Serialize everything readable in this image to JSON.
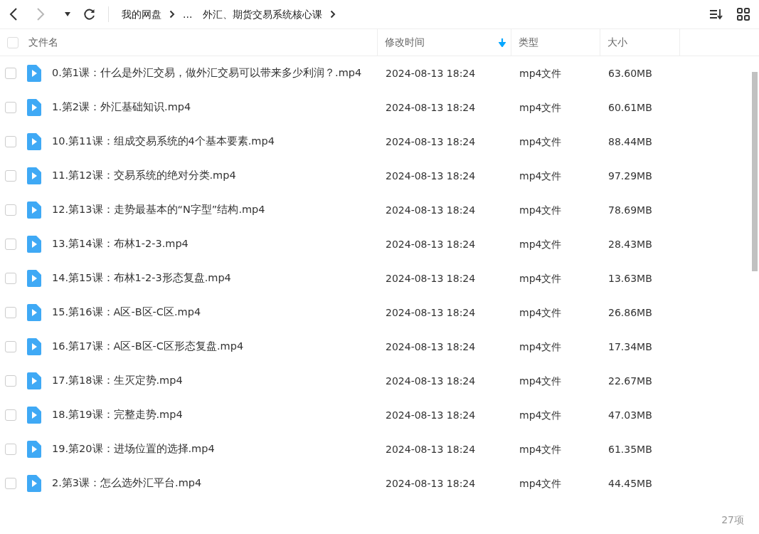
{
  "toolbar": {
    "breadcrumbs": [
      "我的网盘",
      "...",
      "外汇、期货交易系统核心课"
    ],
    "back_disabled": false,
    "forward_disabled": true
  },
  "table": {
    "select_all": {
      "checked": false
    },
    "columns": [
      {
        "label": "文件名",
        "sorted": false
      },
      {
        "label": "修改时间",
        "sorted": true
      },
      {
        "label": "类型",
        "sorted": false
      },
      {
        "label": "大小",
        "sorted": false
      }
    ],
    "rows": [
      {
        "name": "0.第1课：什么是外汇交易，做外汇交易可以带来多少利润？.mp4",
        "modified": "2024-08-13 18:24",
        "type": "mp4文件",
        "size": "63.60MB",
        "checked": false
      },
      {
        "name": "1.第2课：外汇基础知识.mp4",
        "modified": "2024-08-13 18:24",
        "type": "mp4文件",
        "size": "60.61MB",
        "checked": false
      },
      {
        "name": "10.第11课：组成交易系统的4个基本要素.mp4",
        "modified": "2024-08-13 18:24",
        "type": "mp4文件",
        "size": "88.44MB",
        "checked": false
      },
      {
        "name": "11.第12课：交易系统的绝对分类.mp4",
        "modified": "2024-08-13 18:24",
        "type": "mp4文件",
        "size": "97.29MB",
        "checked": false
      },
      {
        "name": "12.第13课：走势最基本的“N字型”结构.mp4",
        "modified": "2024-08-13 18:24",
        "type": "mp4文件",
        "size": "78.69MB",
        "checked": false
      },
      {
        "name": "13.第14课：布林1-2-3.mp4",
        "modified": "2024-08-13 18:24",
        "type": "mp4文件",
        "size": "28.43MB",
        "checked": false
      },
      {
        "name": "14.第15课：布林1-2-3形态复盘.mp4",
        "modified": "2024-08-13 18:24",
        "type": "mp4文件",
        "size": "13.63MB",
        "checked": false
      },
      {
        "name": "15.第16课：A区-B区-C区.mp4",
        "modified": "2024-08-13 18:24",
        "type": "mp4文件",
        "size": "26.86MB",
        "checked": false
      },
      {
        "name": "16.第17课：A区-B区-C区形态复盘.mp4",
        "modified": "2024-08-13 18:24",
        "type": "mp4文件",
        "size": "17.34MB",
        "checked": false
      },
      {
        "name": "17.第18课：生灭定势.mp4",
        "modified": "2024-08-13 18:24",
        "type": "mp4文件",
        "size": "22.67MB",
        "checked": false
      },
      {
        "name": "18.第19课：完整走势.mp4",
        "modified": "2024-08-13 18:24",
        "type": "mp4文件",
        "size": "47.03MB",
        "checked": false
      },
      {
        "name": "19.第20课：进场位置的选择.mp4",
        "modified": "2024-08-13 18:24",
        "type": "mp4文件",
        "size": "61.35MB",
        "checked": false
      },
      {
        "name": "2.第3课：怎么选外汇平台.mp4",
        "modified": "2024-08-13 18:24",
        "type": "mp4文件",
        "size": "44.45MB",
        "checked": false
      }
    ]
  },
  "status_bar": {
    "count": "27项"
  }
}
